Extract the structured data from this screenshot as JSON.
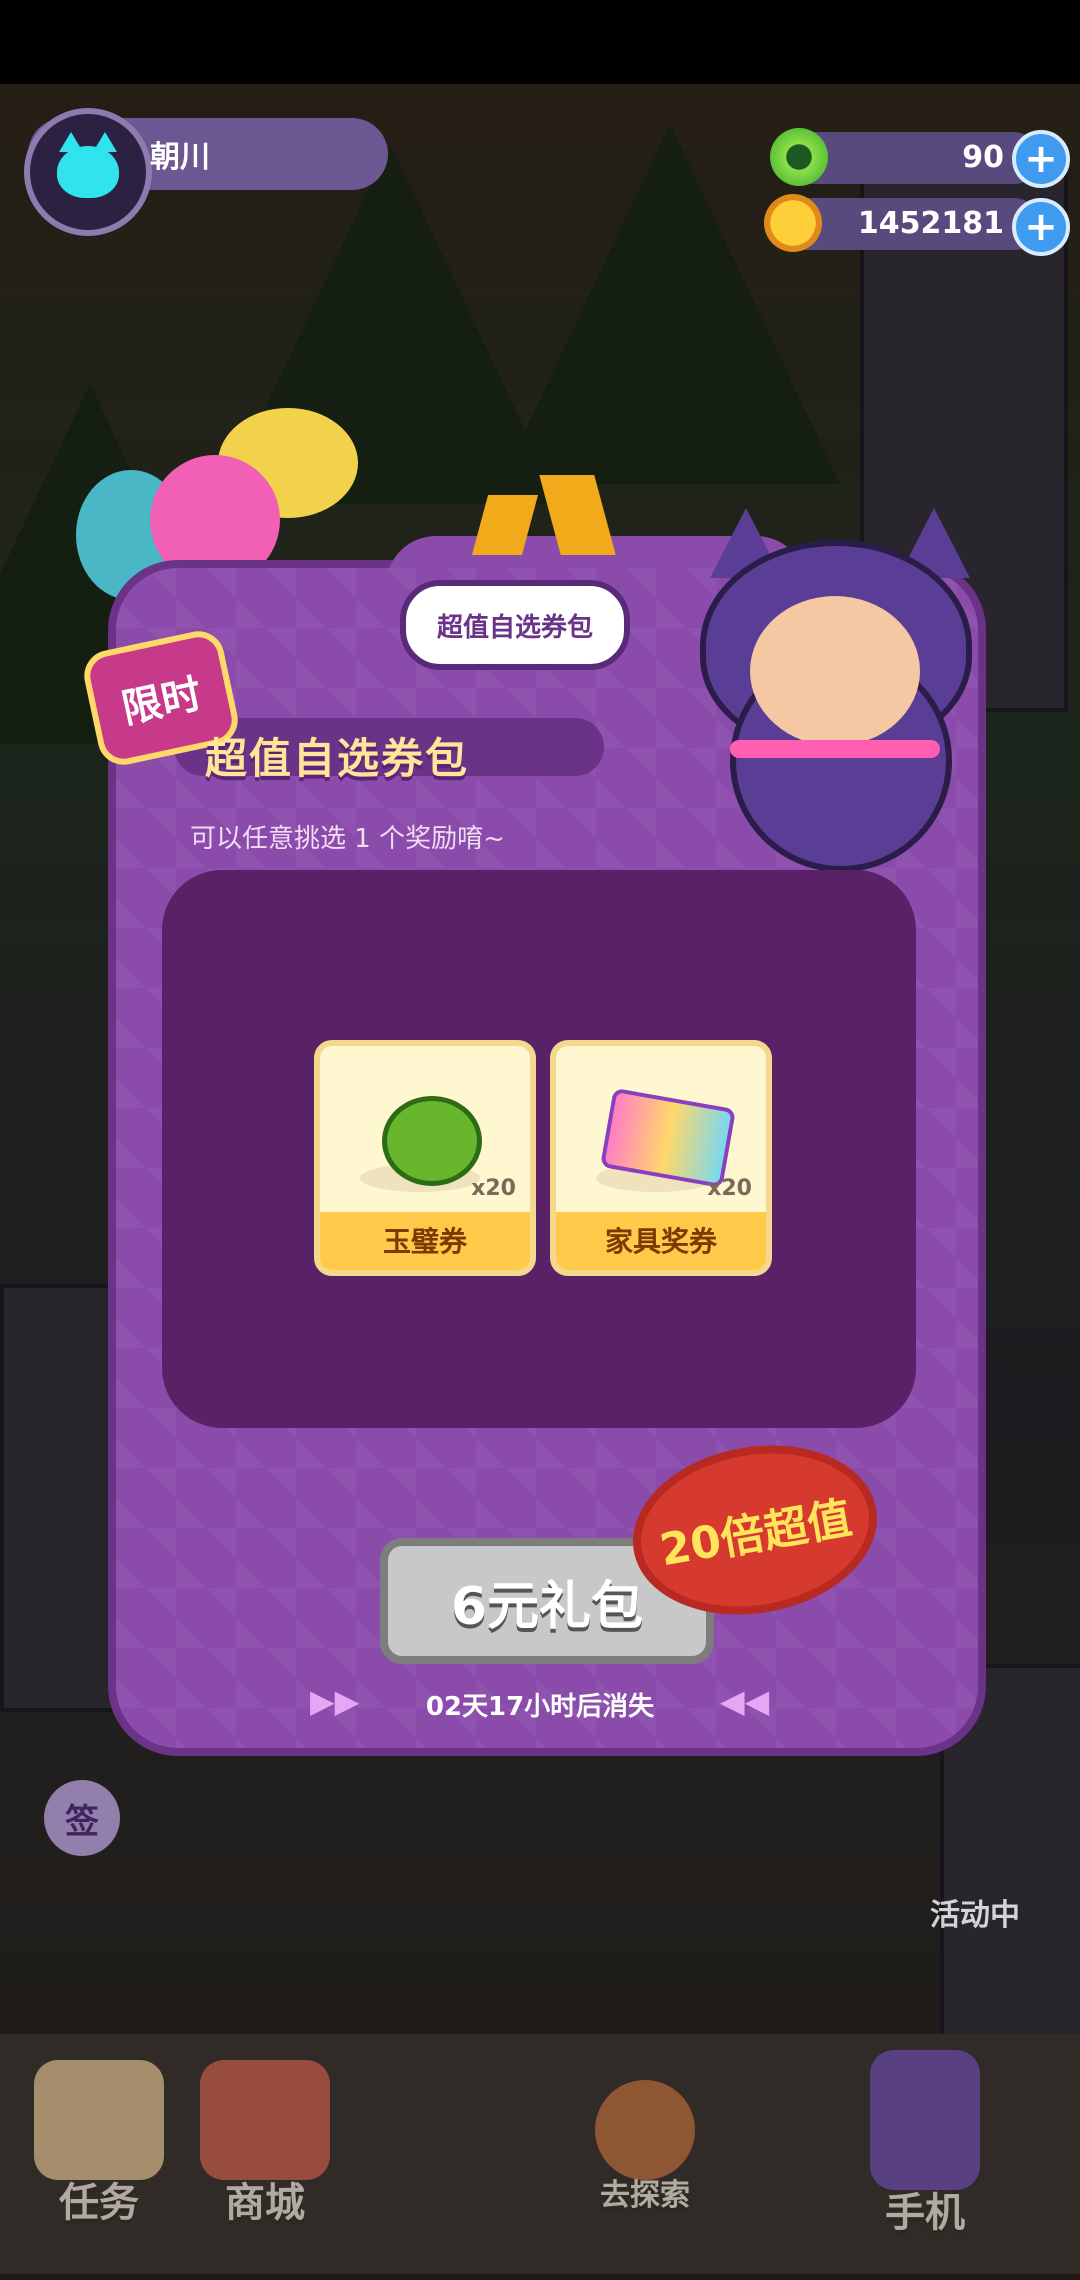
{
  "player": {
    "name": "朝川"
  },
  "currencies": [
    {
      "icon": "green-gem-icon",
      "value": "90"
    },
    {
      "icon": "planet-coin-icon",
      "value": "1452181"
    }
  ],
  "popup": {
    "bubble_text": "超值自选券包",
    "limited_badge": "限时",
    "title": "超值自选券包",
    "subtitle": "可以任意挑选 1 个奖励唷~",
    "items": [
      {
        "name": "玉璧券",
        "qty": "x20",
        "icon": "green-bottlecap-icon"
      },
      {
        "name": "家具奖券",
        "qty": "x20",
        "icon": "ticket-icon"
      }
    ],
    "value_badge": "20倍超值",
    "buy_label": "6元礼包",
    "countdown": "02天17小时后消失"
  },
  "background": {
    "activity_label": "活动中",
    "sign_badge": "签"
  },
  "bottom_nav": [
    {
      "label": "任务"
    },
    {
      "label": "商城"
    },
    {
      "label": "去探索"
    },
    {
      "label": "手机"
    }
  ],
  "colors": {
    "modal_bg": "#8a4bab",
    "inner_panel": "#5a2266",
    "accent_yellow": "#ffc94a",
    "plus_button": "#3f9bf0"
  }
}
